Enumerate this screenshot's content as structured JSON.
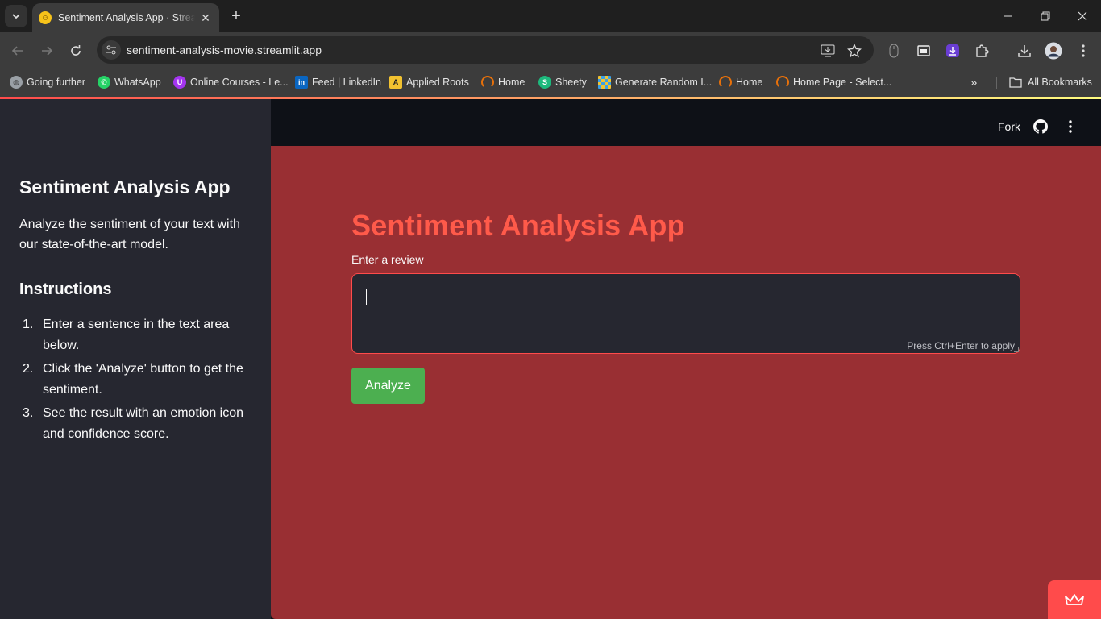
{
  "browser": {
    "tab": {
      "title": "Sentiment Analysis App · Streamlit"
    },
    "url": "sentiment-analysis-movie.streamlit.app",
    "bookmarks": [
      {
        "label": "Going further",
        "icon": "globe-icon",
        "color": "#9aa0a6"
      },
      {
        "label": "WhatsApp",
        "icon": "whatsapp-icon",
        "color": "#25d366"
      },
      {
        "label": "Online Courses - Le...",
        "icon": "udemy-icon",
        "color": "#a435f0"
      },
      {
        "label": "Feed | LinkedIn",
        "icon": "linkedin-icon",
        "color": "#0a66c2"
      },
      {
        "label": "Applied Roots",
        "icon": "appliedroots-icon",
        "color": "#f2c230"
      },
      {
        "label": "Home",
        "icon": "loader-icon",
        "color": "#e8710a"
      },
      {
        "label": "Sheety",
        "icon": "sheety-icon",
        "color": "#1db97d"
      },
      {
        "label": "Generate Random I...",
        "icon": "grid-icon",
        "color": "#3aa0e8"
      },
      {
        "label": "Home",
        "icon": "loader-icon",
        "color": "#e8710a"
      },
      {
        "label": "Home Page - Select...",
        "icon": "loader-icon",
        "color": "#e8710a"
      }
    ],
    "all_bookmarks": "All Bookmarks"
  },
  "header": {
    "fork": "Fork"
  },
  "sidebar": {
    "title": "Sentiment Analysis App",
    "description": "Analyze the sentiment of your text with our state-of-the-art model.",
    "instructions_heading": "Instructions",
    "instructions": [
      {
        "num": "1.",
        "text": "Enter a sentence in the text area below."
      },
      {
        "num": "2.",
        "text": "Click the 'Analyze' button to get the sentiment."
      },
      {
        "num": "3.",
        "text": "See the result with an emotion icon and confidence score."
      }
    ]
  },
  "main": {
    "title": "Sentiment Analysis App",
    "input_label": "Enter a review",
    "input_value": "",
    "input_hint": "Press Ctrl+Enter to apply",
    "analyze_label": "Analyze"
  },
  "colors": {
    "main_bg": "#992f33",
    "title": "#ff5a4a",
    "button": "#4caf50",
    "sidebar_bg": "#262730",
    "header_bg": "#0e1117",
    "accent": "#ff4b4b"
  }
}
